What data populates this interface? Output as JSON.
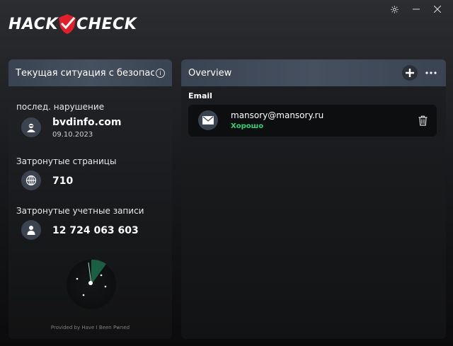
{
  "app": {
    "logo_left": "HACK",
    "logo_right": "CHECK"
  },
  "left_panel": {
    "title": "Текущая ситуация с безопасностью",
    "last_breach_label": "послед. нарушение",
    "last_breach_site": "bvdinfo.com",
    "last_breach_date": "09.10.2023",
    "affected_pages_label": "Затронутые страницы",
    "affected_pages_value": "710",
    "affected_accounts_label": "Затронутые учетные записи",
    "affected_accounts_value": "12 724 063 603",
    "credit": "Provided by Have I Been Pwned"
  },
  "right_panel": {
    "title": "Overview",
    "group_label": "Email",
    "entries": [
      {
        "email": "mansory@mansory.ru",
        "status": "Хорошо"
      }
    ]
  },
  "colors": {
    "status_good": "#2ed27a",
    "header_bg": "#46505f",
    "logo_red": "#e0202a"
  }
}
